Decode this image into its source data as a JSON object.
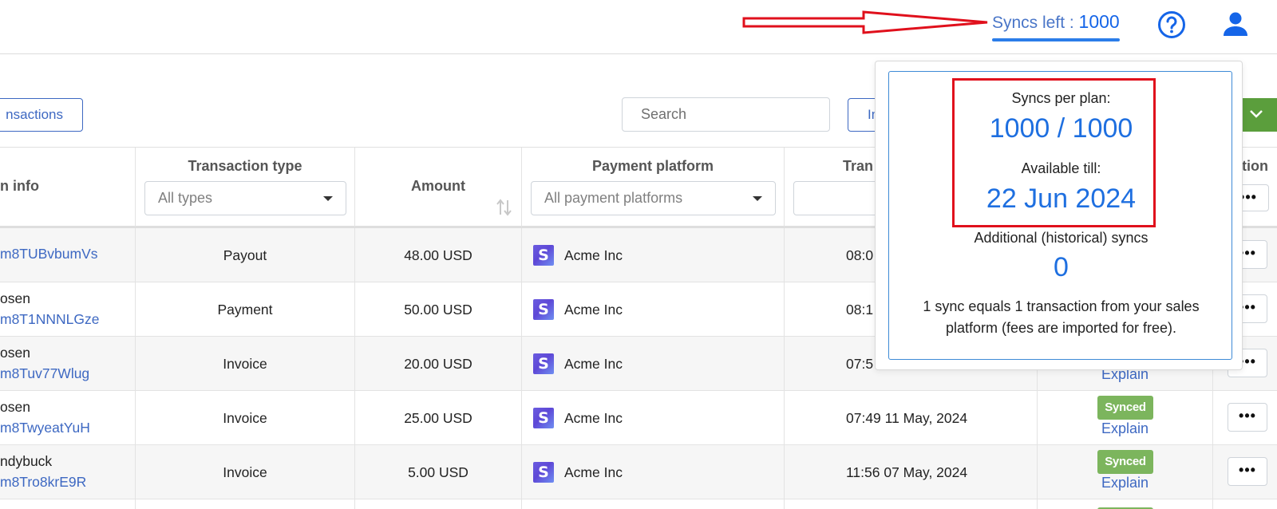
{
  "header": {
    "syncs_left_label": "Syncs left : ",
    "syncs_left_value": "1000",
    "help_icon": "question-circle-icon",
    "user_icon": "user-icon",
    "annotation_arrow_color": "#e0101c"
  },
  "toolbar": {
    "transactions_button": "nsactions",
    "search_placeholder": "Search",
    "import_button": "Im",
    "green_button_icon": "chevron-down-icon"
  },
  "table": {
    "columns": {
      "customer_info": "n info",
      "transaction_type": "Transaction type",
      "transaction_type_filter": "All types",
      "amount": "Amount",
      "payment_platform": "Payment platform",
      "payment_platform_filter": "All payment platforms",
      "transaction_date": "Tran",
      "action": "ction"
    },
    "rows": [
      {
        "customer_name": "",
        "customer_id": "m8TUBvbumVs",
        "type": "Payout",
        "amount": "48.00 USD",
        "platform": "Acme Inc",
        "date": "08:0",
        "status": "",
        "explain": ""
      },
      {
        "customer_name": "osen",
        "customer_id": "m8T1NNNLGze",
        "type": "Payment",
        "amount": "50.00 USD",
        "platform": "Acme Inc",
        "date": "08:1",
        "status": "",
        "explain": ""
      },
      {
        "customer_name": "osen",
        "customer_id": "m8Tuv77Wlug",
        "type": "Invoice",
        "amount": "20.00 USD",
        "platform": "Acme Inc",
        "date": "07:5",
        "status": "",
        "explain": "Explain"
      },
      {
        "customer_name": "osen",
        "customer_id": "m8TwyeatYuH",
        "type": "Invoice",
        "amount": "25.00 USD",
        "platform": "Acme Inc",
        "date": "07:49 11 May, 2024",
        "status": "Synced",
        "explain": "Explain"
      },
      {
        "customer_name": "ndybuck",
        "customer_id": "m8Tro8krE9R",
        "type": "Invoice",
        "amount": "5.00 USD",
        "platform": "Acme Inc",
        "date": "11:56 07 May, 2024",
        "status": "Synced",
        "explain": "Explain"
      }
    ],
    "platform_logo_letter": "S",
    "more_button": "•••"
  },
  "popover": {
    "syncs_per_plan_label": "Syncs per plan:",
    "syncs_per_plan_value": "1000 / 1000",
    "available_till_label": "Available till:",
    "available_till_value": "22 Jun 2024",
    "additional_label": "Additional (historical) syncs",
    "additional_value": "0",
    "note": "1 sync equals 1 transaction from your sales platform (fees are imported for free)."
  }
}
